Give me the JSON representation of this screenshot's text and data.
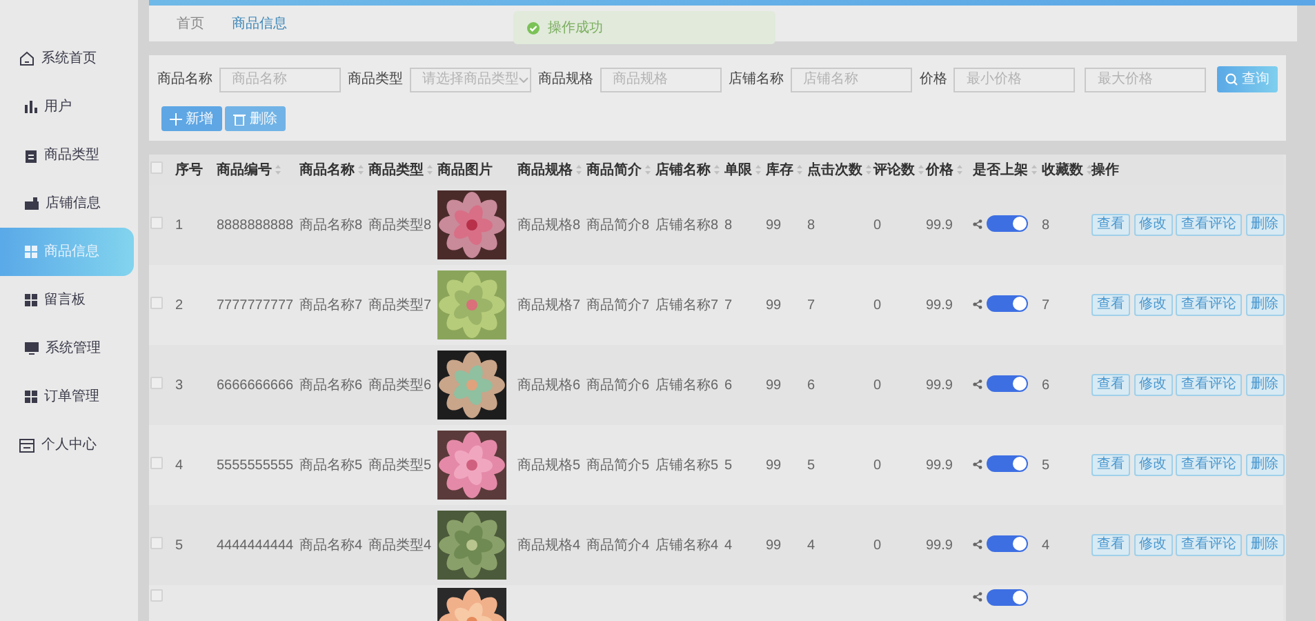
{
  "sidebar": {
    "items": [
      {
        "label": "系统首页",
        "selected": false
      },
      {
        "label": "用户",
        "selected": false
      },
      {
        "label": "商品类型",
        "selected": false
      },
      {
        "label": "店铺信息",
        "selected": false
      },
      {
        "label": "商品信息",
        "selected": true
      },
      {
        "label": "留言板",
        "selected": false
      },
      {
        "label": "系统管理",
        "selected": false
      },
      {
        "label": "订单管理",
        "selected": false
      },
      {
        "label": "个人中心",
        "selected": false
      }
    ]
  },
  "breadcrumb": [
    {
      "label": "首页",
      "selected": false
    },
    {
      "label": "商品信息",
      "selected": true
    }
  ],
  "toast": {
    "kind": "success",
    "message": "操作成功"
  },
  "search": {
    "fields": [
      {
        "kind": "input",
        "label": "商品名称",
        "placeholder": "商品名称"
      },
      {
        "kind": "select",
        "label": "商品类型",
        "placeholder": "请选择商品类型"
      },
      {
        "kind": "input",
        "label": "商品规格",
        "placeholder": "商品规格"
      },
      {
        "kind": "input",
        "label": "店铺名称",
        "placeholder": "店铺名称"
      },
      {
        "kind": "range",
        "label": "价格",
        "placeholders": [
          "最小价格",
          "最大价格"
        ]
      }
    ],
    "button": "查询"
  },
  "actions": [
    {
      "kind": "add",
      "label": "新增"
    },
    {
      "kind": "delete",
      "label": "删除"
    }
  ],
  "table": {
    "select_all": {
      "checked": false
    },
    "columns": [
      {
        "label": "序号",
        "sortable": false
      },
      {
        "label": "商品编号",
        "sortable": true
      },
      {
        "label": "商品名称",
        "sortable": true
      },
      {
        "label": "商品类型",
        "sortable": true
      },
      {
        "label": "商品图片",
        "sortable": false
      },
      {
        "label": "商品规格",
        "sortable": true
      },
      {
        "label": "商品简介",
        "sortable": true
      },
      {
        "label": "店铺名称",
        "sortable": true
      },
      {
        "label": "单限",
        "sortable": true
      },
      {
        "label": "库存",
        "sortable": true
      },
      {
        "label": "点击次数",
        "sortable": true
      },
      {
        "label": "评论数",
        "sortable": true
      },
      {
        "label": "价格",
        "sortable": true
      },
      {
        "label": "是否上架",
        "sortable": true
      },
      {
        "label": "收藏数",
        "sortable": true
      },
      {
        "label": "操作",
        "sortable": false
      }
    ],
    "rows": [
      {
        "kind": "full",
        "checked": false,
        "cells": [
          "1",
          "8888888888",
          "商品名称8",
          "商品类型8",
          "商品规格8",
          "商品简介8",
          "店铺名称8",
          "8",
          "99",
          "8",
          "0",
          "99.9"
        ],
        "listed": true,
        "favorites": "8",
        "buttons": [
          "查看",
          "修改",
          "查看评论",
          "删除"
        ]
      },
      {
        "kind": "full",
        "checked": false,
        "cells": [
          "2",
          "7777777777",
          "商品名称7",
          "商品类型7",
          "商品规格7",
          "商品简介7",
          "店铺名称7",
          "7",
          "99",
          "7",
          "0",
          "99.9"
        ],
        "listed": true,
        "favorites": "7",
        "buttons": [
          "查看",
          "修改",
          "查看评论",
          "删除"
        ]
      },
      {
        "kind": "full",
        "checked": false,
        "cells": [
          "3",
          "6666666666",
          "商品名称6",
          "商品类型6",
          "商品规格6",
          "商品简介6",
          "店铺名称6",
          "6",
          "99",
          "6",
          "0",
          "99.9"
        ],
        "listed": true,
        "favorites": "6",
        "buttons": [
          "查看",
          "修改",
          "查看评论",
          "删除"
        ]
      },
      {
        "kind": "full",
        "checked": false,
        "cells": [
          "4",
          "5555555555",
          "商品名称5",
          "商品类型5",
          "商品规格5",
          "商品简介5",
          "店铺名称5",
          "5",
          "99",
          "5",
          "0",
          "99.9"
        ],
        "listed": true,
        "favorites": "5",
        "buttons": [
          "查看",
          "修改",
          "查看评论",
          "删除"
        ]
      },
      {
        "kind": "full",
        "checked": false,
        "cells": [
          "5",
          "4444444444",
          "商品名称4",
          "商品类型4",
          "商品规格4",
          "商品简介4",
          "店铺名称4",
          "4",
          "99",
          "4",
          "0",
          "99.9"
        ],
        "listed": true,
        "favorites": "4",
        "buttons": [
          "查看",
          "修改",
          "查看评论",
          "删除"
        ]
      },
      {
        "kind": "cut",
        "checked": false,
        "listed": true
      }
    ]
  }
}
